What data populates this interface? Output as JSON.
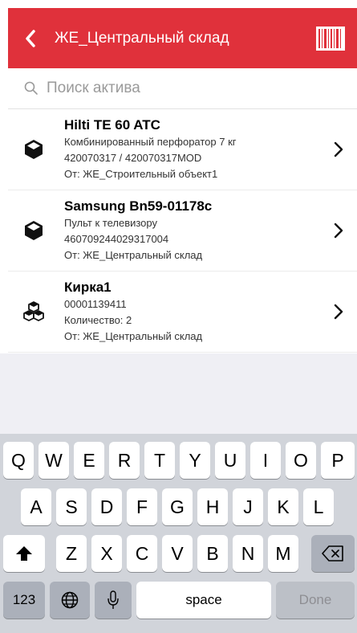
{
  "header": {
    "title": "ЖЕ_Центральный склад",
    "background_color": "#e0313b",
    "back_icon": "chevron-left-icon",
    "barcode_icon": "barcode-icon"
  },
  "search": {
    "placeholder": "Поиск актива",
    "value": ""
  },
  "items": [
    {
      "name": "Hilti TE 60 ATC",
      "line1": "Комбинированный перфоратор 7 кг",
      "line2": "420070317 / 420070317MOD",
      "line3": "От: ЖЕ_Строительный объект1",
      "icon": "box-icon"
    },
    {
      "name": "Samsung Bn59-01178c",
      "line1": "Пульт к телевизору",
      "line2": "460709244029317004",
      "line3": "От: ЖЕ_Центральный склад",
      "icon": "box-icon"
    },
    {
      "name": "Кирка1",
      "line1": "00001139411",
      "line2": "Количество: 2",
      "line3": "От: ЖЕ_Центральный склад",
      "icon": "boxes-icon"
    }
  ],
  "keyboard": {
    "row1": [
      "Q",
      "W",
      "E",
      "R",
      "T",
      "Y",
      "U",
      "I",
      "O",
      "P"
    ],
    "row2": [
      "A",
      "S",
      "D",
      "F",
      "G",
      "H",
      "J",
      "K",
      "L"
    ],
    "row3": [
      "Z",
      "X",
      "C",
      "V",
      "B",
      "N",
      "M"
    ],
    "numbers_key": "123",
    "space_key": "space",
    "done_key": "Done",
    "shift_icon": "shift-icon",
    "backspace_icon": "backspace-icon",
    "globe_icon": "globe-icon",
    "mic_icon": "microphone-icon"
  }
}
